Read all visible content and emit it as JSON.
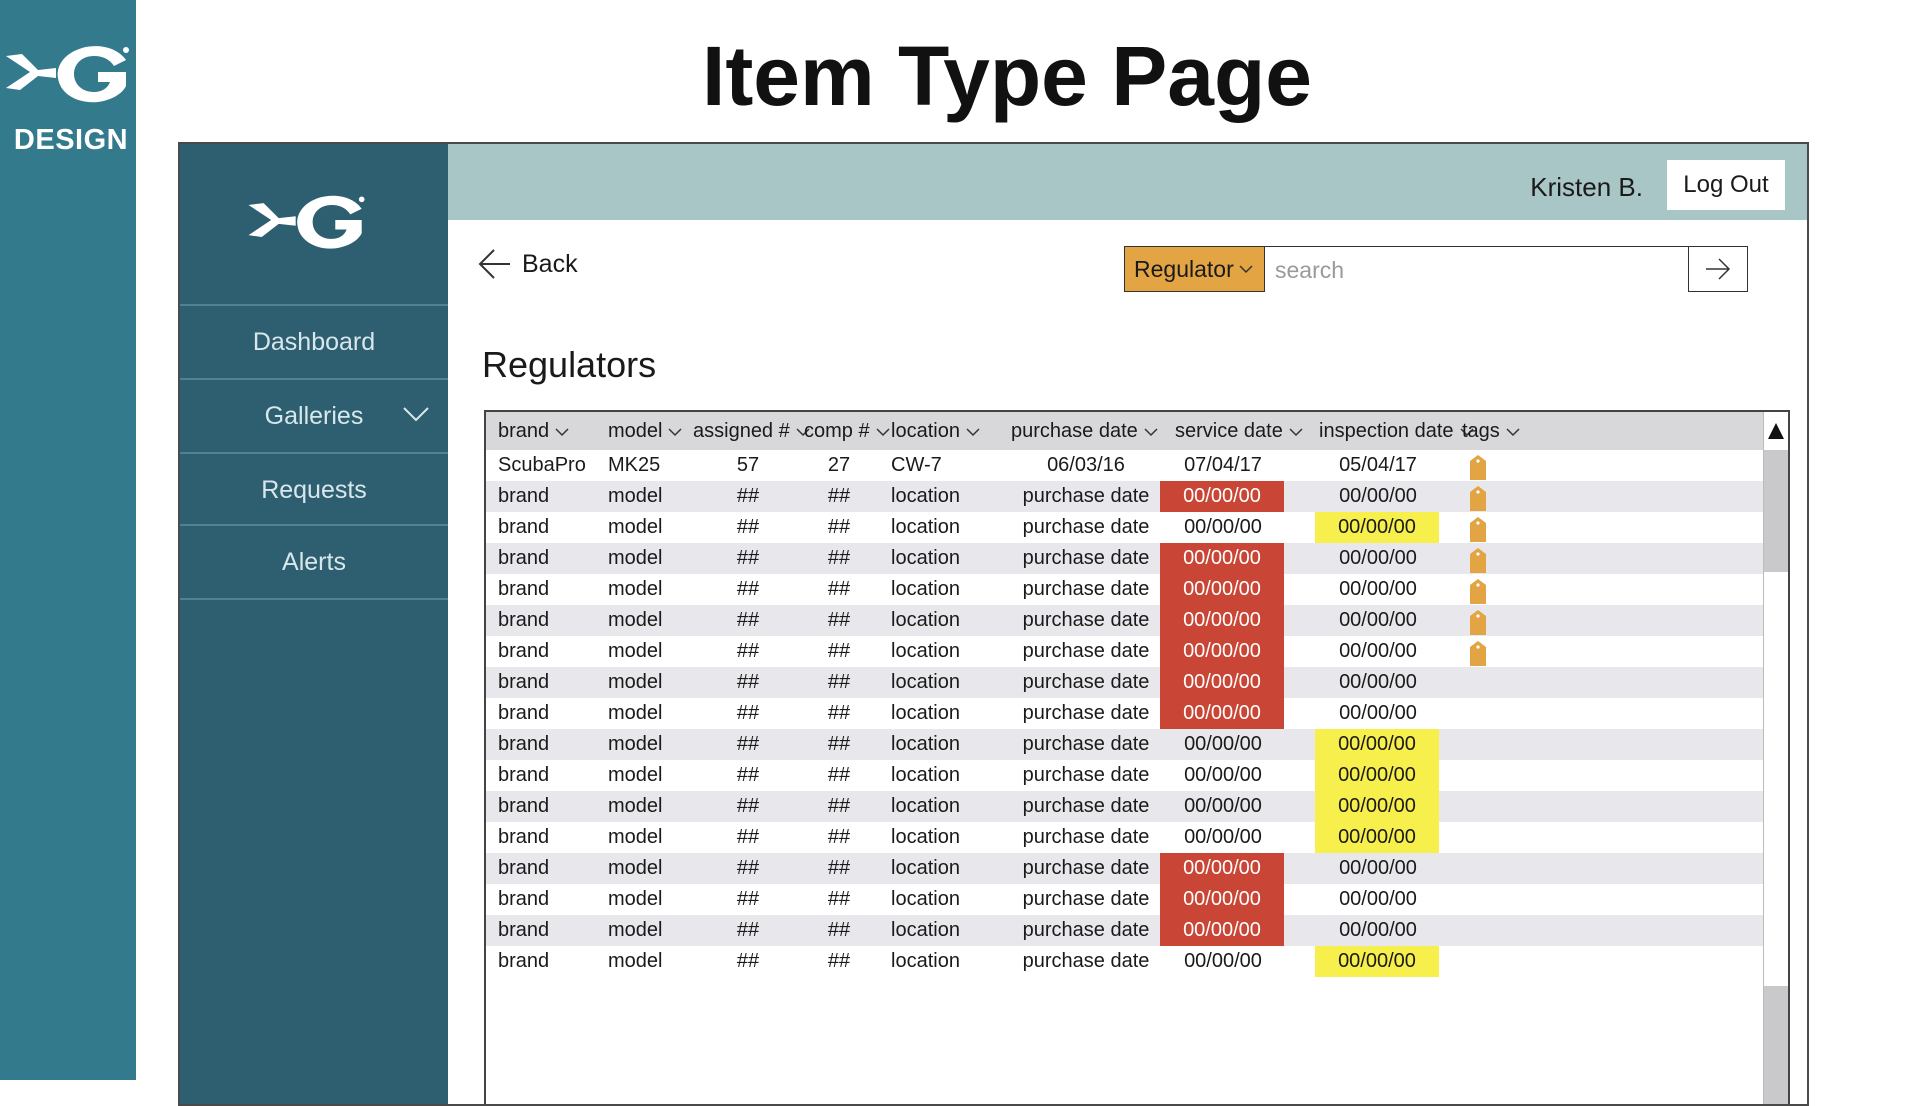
{
  "slide": {
    "brand_label": "DESIGN",
    "title": "Item Type Page"
  },
  "colors": {
    "strip": "#337a8c",
    "sidebar": "#2d5f70",
    "topbar": "#a9c6c7",
    "search_type": "#e3a443",
    "overdue": "#c94535",
    "due_soon": "#f7ef4c",
    "tag": "#e3a443"
  },
  "sidebar": {
    "items": [
      {
        "label": "Dashboard"
      },
      {
        "label": "Galleries"
      },
      {
        "label": "Requests"
      },
      {
        "label": "Alerts"
      }
    ]
  },
  "topbar": {
    "user": "Kristen B.",
    "logout_label": "Log Out"
  },
  "nav": {
    "back_label": "Back"
  },
  "search": {
    "type_label": "Regulator",
    "placeholder": "search"
  },
  "section": {
    "title": "Regulators"
  },
  "table": {
    "columns": [
      "brand",
      "model",
      "assigned #",
      "comp #",
      "location",
      "purchase date",
      "service date",
      "inspection date",
      "tags"
    ],
    "rows": [
      {
        "brand": "ScubaPro",
        "model": "MK25",
        "assigned": "57",
        "comp": "27",
        "location": "CW-7",
        "purchase": "06/03/16",
        "service": "07/04/17",
        "inspection": "05/04/17",
        "service_status": "",
        "inspection_status": "",
        "tag": true
      },
      {
        "brand": "brand",
        "model": "model",
        "assigned": "##",
        "comp": "##",
        "location": "location",
        "purchase": "purchase date",
        "service": "00/00/00",
        "inspection": "00/00/00",
        "service_status": "red",
        "inspection_status": "",
        "tag": true
      },
      {
        "brand": "brand",
        "model": "model",
        "assigned": "##",
        "comp": "##",
        "location": "location",
        "purchase": "purchase date",
        "service": "00/00/00",
        "inspection": "00/00/00",
        "service_status": "",
        "inspection_status": "yellow",
        "tag": true
      },
      {
        "brand": "brand",
        "model": "model",
        "assigned": "##",
        "comp": "##",
        "location": "location",
        "purchase": "purchase date",
        "service": "00/00/00",
        "inspection": "00/00/00",
        "service_status": "red",
        "inspection_status": "",
        "tag": true
      },
      {
        "brand": "brand",
        "model": "model",
        "assigned": "##",
        "comp": "##",
        "location": "location",
        "purchase": "purchase date",
        "service": "00/00/00",
        "inspection": "00/00/00",
        "service_status": "red",
        "inspection_status": "",
        "tag": true
      },
      {
        "brand": "brand",
        "model": "model",
        "assigned": "##",
        "comp": "##",
        "location": "location",
        "purchase": "purchase date",
        "service": "00/00/00",
        "inspection": "00/00/00",
        "service_status": "red",
        "inspection_status": "",
        "tag": true
      },
      {
        "brand": "brand",
        "model": "model",
        "assigned": "##",
        "comp": "##",
        "location": "location",
        "purchase": "purchase date",
        "service": "00/00/00",
        "inspection": "00/00/00",
        "service_status": "red",
        "inspection_status": "",
        "tag": true
      },
      {
        "brand": "brand",
        "model": "model",
        "assigned": "##",
        "comp": "##",
        "location": "location",
        "purchase": "purchase date",
        "service": "00/00/00",
        "inspection": "00/00/00",
        "service_status": "red",
        "inspection_status": "",
        "tag": false
      },
      {
        "brand": "brand",
        "model": "model",
        "assigned": "##",
        "comp": "##",
        "location": "location",
        "purchase": "purchase date",
        "service": "00/00/00",
        "inspection": "00/00/00",
        "service_status": "red",
        "inspection_status": "",
        "tag": false
      },
      {
        "brand": "brand",
        "model": "model",
        "assigned": "##",
        "comp": "##",
        "location": "location",
        "purchase": "purchase date",
        "service": "00/00/00",
        "inspection": "00/00/00",
        "service_status": "",
        "inspection_status": "yellow",
        "tag": false
      },
      {
        "brand": "brand",
        "model": "model",
        "assigned": "##",
        "comp": "##",
        "location": "location",
        "purchase": "purchase date",
        "service": "00/00/00",
        "inspection": "00/00/00",
        "service_status": "",
        "inspection_status": "yellow",
        "tag": false
      },
      {
        "brand": "brand",
        "model": "model",
        "assigned": "##",
        "comp": "##",
        "location": "location",
        "purchase": "purchase date",
        "service": "00/00/00",
        "inspection": "00/00/00",
        "service_status": "",
        "inspection_status": "yellow",
        "tag": false
      },
      {
        "brand": "brand",
        "model": "model",
        "assigned": "##",
        "comp": "##",
        "location": "location",
        "purchase": "purchase date",
        "service": "00/00/00",
        "inspection": "00/00/00",
        "service_status": "",
        "inspection_status": "yellow",
        "tag": false
      },
      {
        "brand": "brand",
        "model": "model",
        "assigned": "##",
        "comp": "##",
        "location": "location",
        "purchase": "purchase date",
        "service": "00/00/00",
        "inspection": "00/00/00",
        "service_status": "red",
        "inspection_status": "",
        "tag": false
      },
      {
        "brand": "brand",
        "model": "model",
        "assigned": "##",
        "comp": "##",
        "location": "location",
        "purchase": "purchase date",
        "service": "00/00/00",
        "inspection": "00/00/00",
        "service_status": "red",
        "inspection_status": "",
        "tag": false
      },
      {
        "brand": "brand",
        "model": "model",
        "assigned": "##",
        "comp": "##",
        "location": "location",
        "purchase": "purchase date",
        "service": "00/00/00",
        "inspection": "00/00/00",
        "service_status": "red",
        "inspection_status": "",
        "tag": false
      },
      {
        "brand": "brand",
        "model": "model",
        "assigned": "##",
        "comp": "##",
        "location": "location",
        "purchase": "purchase date",
        "service": "00/00/00",
        "inspection": "00/00/00",
        "service_status": "",
        "inspection_status": "yellow",
        "tag": false
      }
    ]
  },
  "icons": {
    "brand_logo": "xg-logo-icon",
    "back": "arrow-left-icon",
    "search_go": "arrow-right-icon",
    "dropdown": "chevron-down-icon",
    "tag": "tag-icon",
    "scroll_up": "triangle-up-icon"
  }
}
